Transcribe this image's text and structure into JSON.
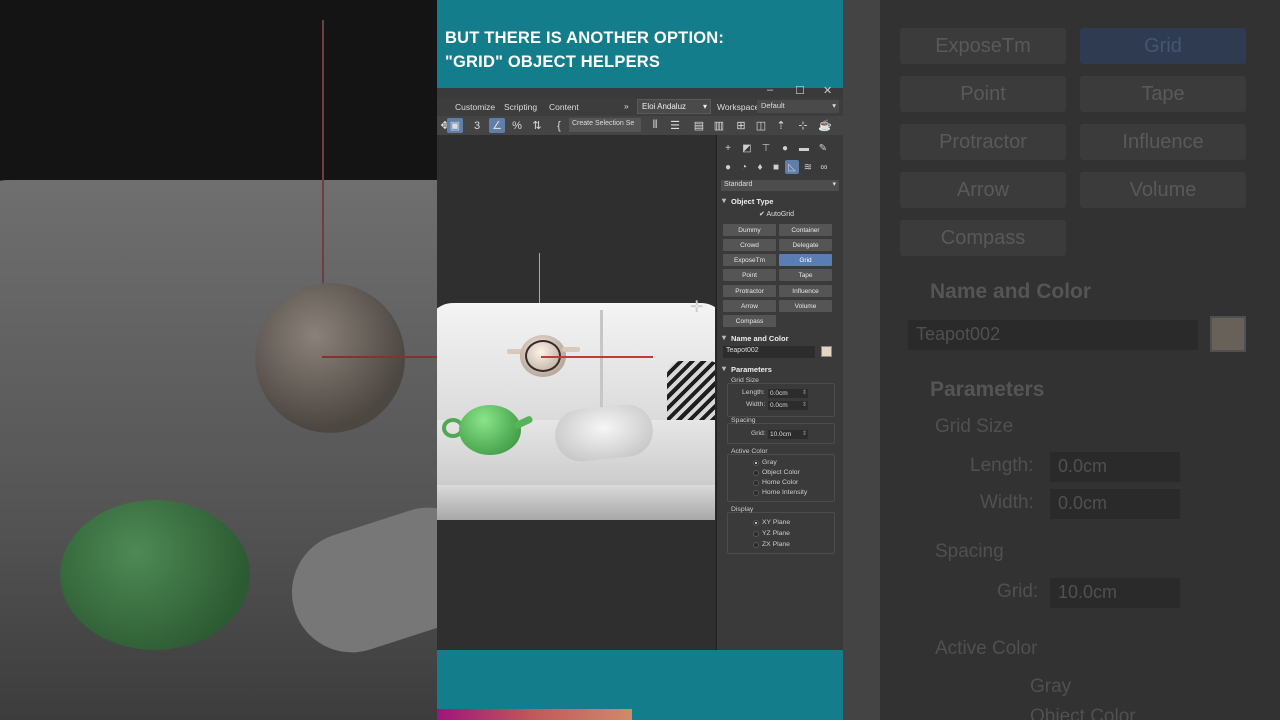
{
  "caption": {
    "line1": "BUT THERE IS ANOTHER OPTION:",
    "line2": "\"GRID\" OBJECT HELPERS"
  },
  "window": {
    "minimize": "–",
    "maximize": "☐",
    "close": "✕"
  },
  "menu": {
    "items": [
      "Customize",
      "Scripting",
      "Content"
    ],
    "overflow": "»",
    "user": "Eloi Andaluz",
    "workspaces_label": "Workspaces:",
    "workspace_value": "Default"
  },
  "toolbar": {
    "selection_set": "Create Selection Se",
    "icons": [
      "move-icon",
      "select-region-icon",
      "snap-3d-icon",
      "angle-snap-icon",
      "percent-snap-icon",
      "spinner-snap-icon",
      "edit-named-sets-icon",
      "mirror-icon",
      "align-icon",
      "layer-explorer-icon",
      "toggle-ribbon-icon",
      "schematic-view-icon",
      "material-editor-icon",
      "render-setup-icon",
      "render-frame-icon"
    ]
  },
  "command_panel": {
    "category_dropdown": "Standard",
    "object_type": {
      "title": "Object Type",
      "autogrid": "AutoGrid",
      "buttons": [
        "Dummy",
        "Container",
        "Crowd",
        "Delegate",
        "ExposeTm",
        "Grid",
        "Point",
        "Tape",
        "Protractor",
        "Influence",
        "Arrow",
        "Volume",
        "Compass"
      ],
      "selected": "Grid"
    },
    "name_and_color": {
      "title": "Name and Color",
      "name": "Teapot002",
      "color": "#e5d6c3"
    },
    "parameters": {
      "title": "Parameters",
      "grid_size_label": "Grid Size",
      "length_label": "Length:",
      "length_value": "0.0cm",
      "width_label": "Width:",
      "width_value": "0.0cm",
      "spacing_label": "Spacing",
      "grid_label": "Grid:",
      "grid_value": "10.0cm",
      "active_color_label": "Active Color",
      "active_color_options": [
        "Gray",
        "Object Color",
        "Home Color",
        "Home Intensity"
      ],
      "active_color_selected": "Gray",
      "display_label": "Display",
      "display_options": [
        "XY Plane",
        "YZ Plane",
        "ZX Plane"
      ],
      "display_selected": "XY Plane"
    }
  },
  "progress": {
    "value": 0.48,
    "colors": [
      "#a0147a",
      "#d08a6a"
    ]
  },
  "accent_color": "#137d8c"
}
